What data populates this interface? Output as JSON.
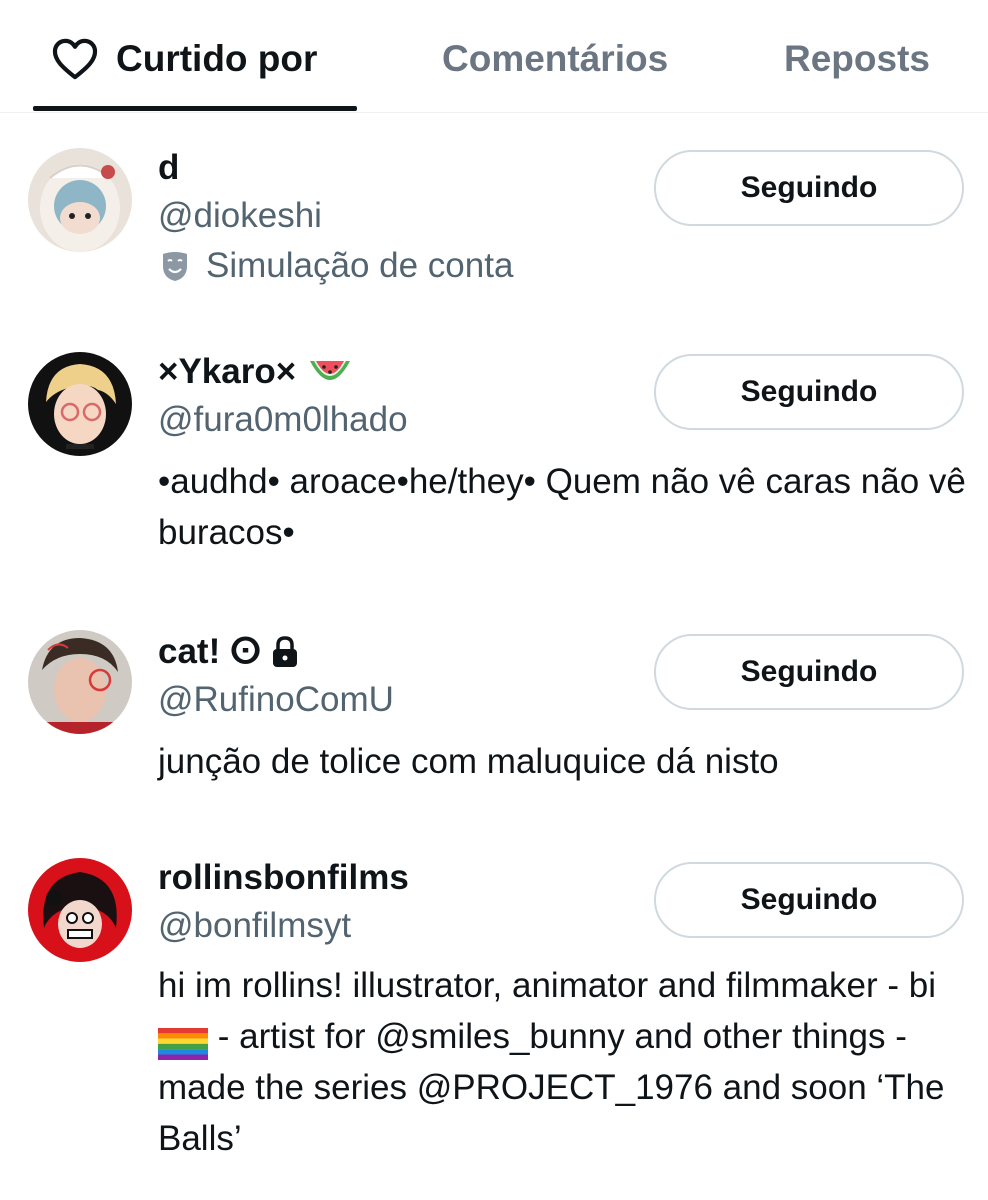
{
  "tabs": [
    {
      "label": "Curtido por",
      "icon": "heart-icon",
      "active": true
    },
    {
      "label": "Comentários",
      "active": false
    },
    {
      "label": "Reposts",
      "active": false
    }
  ],
  "users": [
    {
      "name": "d",
      "handle": "@diokeshi",
      "badge": "Simulação de conta",
      "badge_icon": "theater-mask-icon",
      "button": "Seguindo"
    },
    {
      "name": "×Ykaro×",
      "name_icon": "watermelon-icon",
      "handle": "@fura0m0lhado",
      "bio": "•audhd• aroace•he/they• Quem não vê caras não vê buracos•",
      "button": "Seguindo"
    },
    {
      "name": "cat! ⵙ",
      "name_icon": "lock-icon",
      "handle": "@RufinoComU",
      "bio": "junção de tolice com maluquice dá nisto",
      "button": "Seguindo"
    },
    {
      "name": "rollinsbonfilms",
      "handle": "@bonfilmsyt",
      "bio_parts": {
        "before_flag": "hi im rollins! illustrator, animator and filmmaker - bi ",
        "after_flag": " - artist for @smiles_bunny and other things - made the series @PROJECT_1976 and soon ‘The Balls’"
      },
      "bio_icon": "rainbow-flag-icon",
      "button": "Seguindo"
    }
  ],
  "colors": {
    "text": "#0f1419",
    "muted": "#536471",
    "tab_inactive": "#6b7682",
    "button_border": "#cfd9de"
  }
}
